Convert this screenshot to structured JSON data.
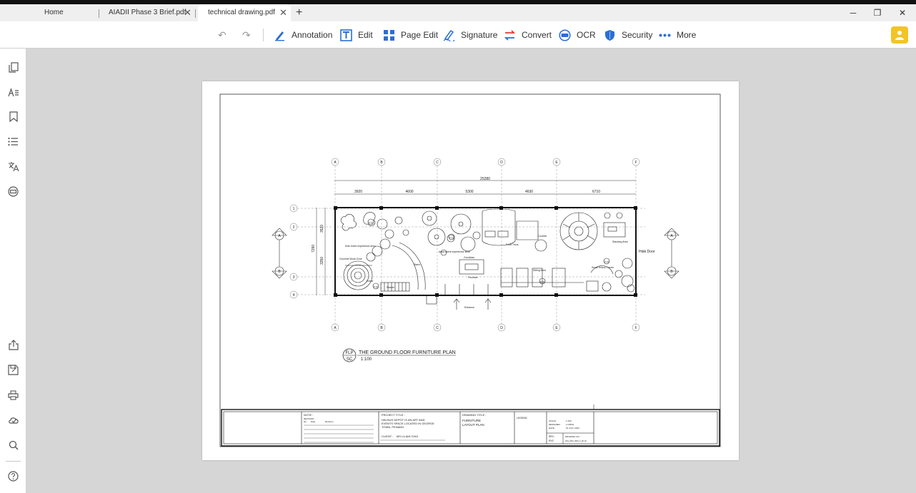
{
  "tabs": [
    {
      "label": "Home",
      "active": false
    },
    {
      "label": "AIADII Phase 3 Brief.pdf",
      "active": false
    },
    {
      "label": "technical drawing.pdf",
      "active": true
    }
  ],
  "new_tab_label": "+",
  "window_controls": {
    "minimize": "─",
    "restore": "❐",
    "close": "✕"
  },
  "toolbar": {
    "annotation": "Annotation",
    "edit": "Edit",
    "page_edit": "Page Edit",
    "signature": "Signature",
    "convert": "Convert",
    "ocr": "OCR",
    "security": "Security",
    "more": "More"
  },
  "sidebar_icons": [
    "pages-icon",
    "text-recognition-icon",
    "bookmark-icon",
    "outline-list-icon",
    "translate-icon",
    "ocr-scan-icon",
    "share-icon",
    "save-as-icon",
    "print-icon",
    "cloud-sign-icon",
    "search-icon",
    "help-icon"
  ],
  "colors": {
    "accent": "#2b6fd6",
    "avatar": "#f3c426",
    "convert_red": "#e03a3a"
  },
  "drawing": {
    "grid_letters": [
      "A",
      "B",
      "C",
      "D",
      "E",
      "F"
    ],
    "grid_numbers": [
      "1",
      "2",
      "3",
      "4"
    ],
    "overall_dim": "25280",
    "bay_dims": [
      "3920",
      "4600",
      "5300",
      "4630",
      "6710"
    ],
    "side_dims": [
      "3520",
      "7290",
      "3350"
    ],
    "room_labels": [
      "Kids event experience area",
      "Gourmet Work Zone",
      "Stairs",
      "Adult event experience area",
      "Food Truck",
      "Counter",
      "Sitting Area",
      "Small Snack Corner",
      "Stacking Area",
      "Hide Door",
      "Entrance",
      "Fountain",
      "Dome",
      "Planter",
      "Gondolas"
    ],
    "callouts": [
      "F12",
      "F13",
      "F14",
      "F15",
      "F16"
    ],
    "title": "THE GROUND FLOOR FURNITURE PLAN",
    "badge_top": "FLP",
    "badge_bottom": "SC",
    "scale": "1:100"
  },
  "title_block": {
    "note_label": "NOTE :",
    "revision_label": "REVISION :",
    "rev_cols": [
      "No.",
      "Date",
      "Revision"
    ],
    "project_title_label": "PROJECT TITLE :",
    "project_lines": [
      "HIN BUS DEPOT IS AN ART AND",
      "EVENTS SPACE LOCATED IN GEORGE",
      "TOWN, PENANG."
    ],
    "client_label": "CLIENT :",
    "client_value": "MS LILIAN CHIA",
    "drawing_title_label": "DRAWING TITLE :",
    "drawing_title_lines": [
      "FURNITURE",
      "LAYOUT PLAN"
    ],
    "legend_label": "LEGEND :",
    "scale_label": "SCALE :",
    "scale_value": "1:100",
    "designer_label": "DESIGNER :",
    "designer_value": "LI MING",
    "date_label": "DATE :",
    "date_value": "16 JULY 2023",
    "rev_label": "REV :",
    "rev_value": "RV2",
    "drawing_no_label": "DRAWING NO. :",
    "drawing_no_value": "AI01_2023_LM01_F_08_02"
  }
}
